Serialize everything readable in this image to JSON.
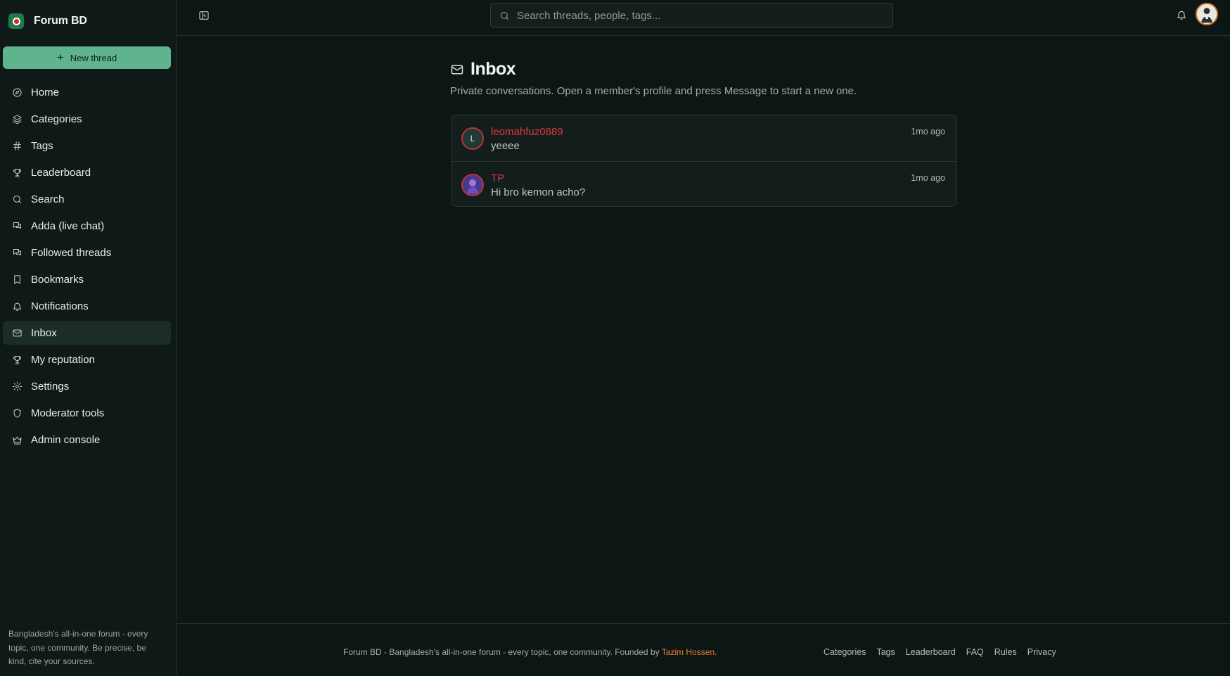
{
  "brand": {
    "name": "Forum BD",
    "accent": "#5fb48e"
  },
  "sidebar": {
    "new_thread_label": "New thread",
    "items": [
      {
        "label": "Home",
        "icon": "compass-icon",
        "active": false
      },
      {
        "label": "Categories",
        "icon": "layers-icon",
        "active": false
      },
      {
        "label": "Tags",
        "icon": "hash-icon",
        "active": false
      },
      {
        "label": "Leaderboard",
        "icon": "trophy-icon",
        "active": false
      },
      {
        "label": "Search",
        "icon": "search-icon",
        "active": false
      },
      {
        "label": "Adda (live chat)",
        "icon": "chat-icon",
        "active": false
      },
      {
        "label": "Followed threads",
        "icon": "chat-icon",
        "active": false
      },
      {
        "label": "Bookmarks",
        "icon": "bookmark-icon",
        "active": false
      },
      {
        "label": "Notifications",
        "icon": "bell-icon",
        "active": false
      },
      {
        "label": "Inbox",
        "icon": "mail-icon",
        "active": true
      },
      {
        "label": "My reputation",
        "icon": "trophy-icon",
        "active": false
      },
      {
        "label": "Settings",
        "icon": "gear-icon",
        "active": false
      },
      {
        "label": "Moderator tools",
        "icon": "shield-icon",
        "active": false
      },
      {
        "label": "Admin console",
        "icon": "crown-icon",
        "active": false
      }
    ],
    "tagline": "Bangladesh's all-in-one forum - every topic, one community. Be precise, be kind, cite your sources."
  },
  "topbar": {
    "search_placeholder": "Search threads, people, tags..."
  },
  "main": {
    "title": "Inbox",
    "subtitle": "Private conversations. Open a member's profile and press Message to start a new one.",
    "threads": [
      {
        "name": "leomahfuz0889",
        "avatar_letter": "L",
        "message": "yeeee",
        "time": "1mo ago"
      },
      {
        "name": "TP",
        "avatar_letter": "",
        "message": "Hi bro kemon acho?",
        "time": "1mo ago"
      }
    ]
  },
  "footer": {
    "text": "Forum BD - Bangladesh's all-in-one forum - every topic, one community. Founded by ",
    "founder": "Tazim Hossen",
    "founder_suffix": ".",
    "links": [
      "Categories",
      "Tags",
      "Leaderboard",
      "FAQ",
      "Rules",
      "Privacy"
    ]
  }
}
